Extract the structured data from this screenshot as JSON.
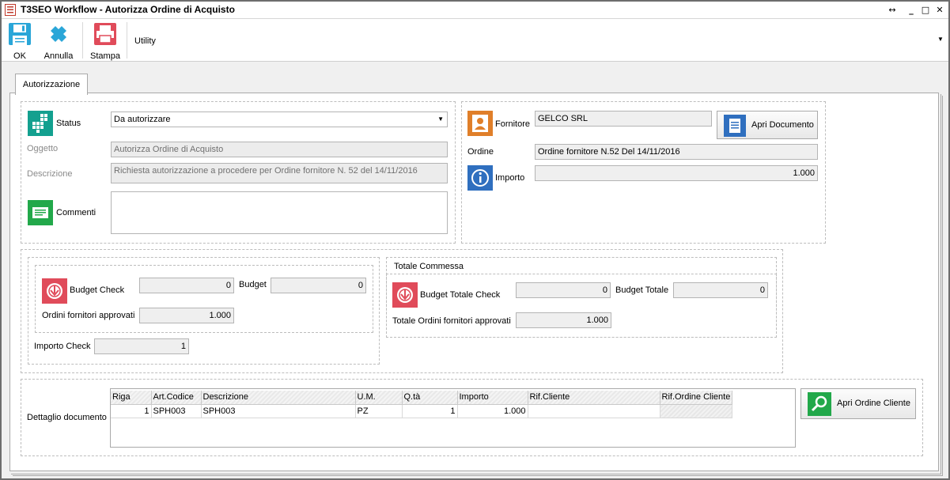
{
  "window": {
    "title": "T3SEO Workflow - Autorizza Ordine di Acquisto",
    "controls": [
      "↔",
      "_",
      "□",
      "✕"
    ]
  },
  "toolbar": {
    "ok_label": "OK",
    "annulla_label": "Annulla",
    "stampa_label": "Stampa",
    "utility_label": "Utility",
    "colors": {
      "ok": "#2aa6d8",
      "annulla": "#2aa6d8",
      "stampa": "#e04b5a"
    }
  },
  "tabs": [
    {
      "label": "Autorizzazione"
    }
  ],
  "autorizzazione": {
    "status_label": "Status",
    "status_value": "Da autorizzare",
    "oggetto_label": "Oggetto",
    "oggetto_value": "Autorizza Ordine di Acquisto",
    "descrizione_label": "Descrizione",
    "descrizione_value": "Richiesta autorizzazione a procedere per Ordine fornitore N.  52 del 14/11/2016",
    "commenti_label": "Commenti",
    "commenti_value": ""
  },
  "fornitore": {
    "fornitore_label": "Fornitore",
    "fornitore_value": "GELCO SRL",
    "apri_documento_label": "Apri Documento",
    "ordine_label": "Ordine",
    "ordine_value": "Ordine fornitore N.52 Del 14/11/2016",
    "importo_label": "Importo",
    "importo_value": "1.000"
  },
  "budget": {
    "budget_check_label": "Budget Check",
    "budget_check_value": "0",
    "budget_label": "Budget",
    "budget_value": "0",
    "ordini_label": "Ordini fornitori approvati",
    "ordini_value": "1.000",
    "importo_check_label": "Importo Check",
    "importo_check_value": "1"
  },
  "totale_commessa": {
    "title": "Totale Commessa",
    "budget_totale_check_label": "Budget Totale Check",
    "budget_totale_check_value": "0",
    "budget_totale_label": "Budget Totale",
    "budget_totale_value": "0",
    "totale_ordini_label": "Totale Ordini fornitori approvati",
    "totale_ordini_value": "1.000"
  },
  "dettaglio": {
    "label": "Dettaglio documento",
    "apri_ordine_cliente_label": "Apri Ordine Cliente",
    "columns": [
      "Riga",
      "Art.Codice",
      "Descrizione",
      "U.M.",
      "Q.tà",
      "Importo",
      "Rif.Cliente",
      "Rif.Ordine Cliente"
    ],
    "rows": [
      [
        "1",
        "SPH003",
        "SPH003",
        "PZ",
        "1",
        "1.000",
        "",
        ""
      ]
    ]
  }
}
